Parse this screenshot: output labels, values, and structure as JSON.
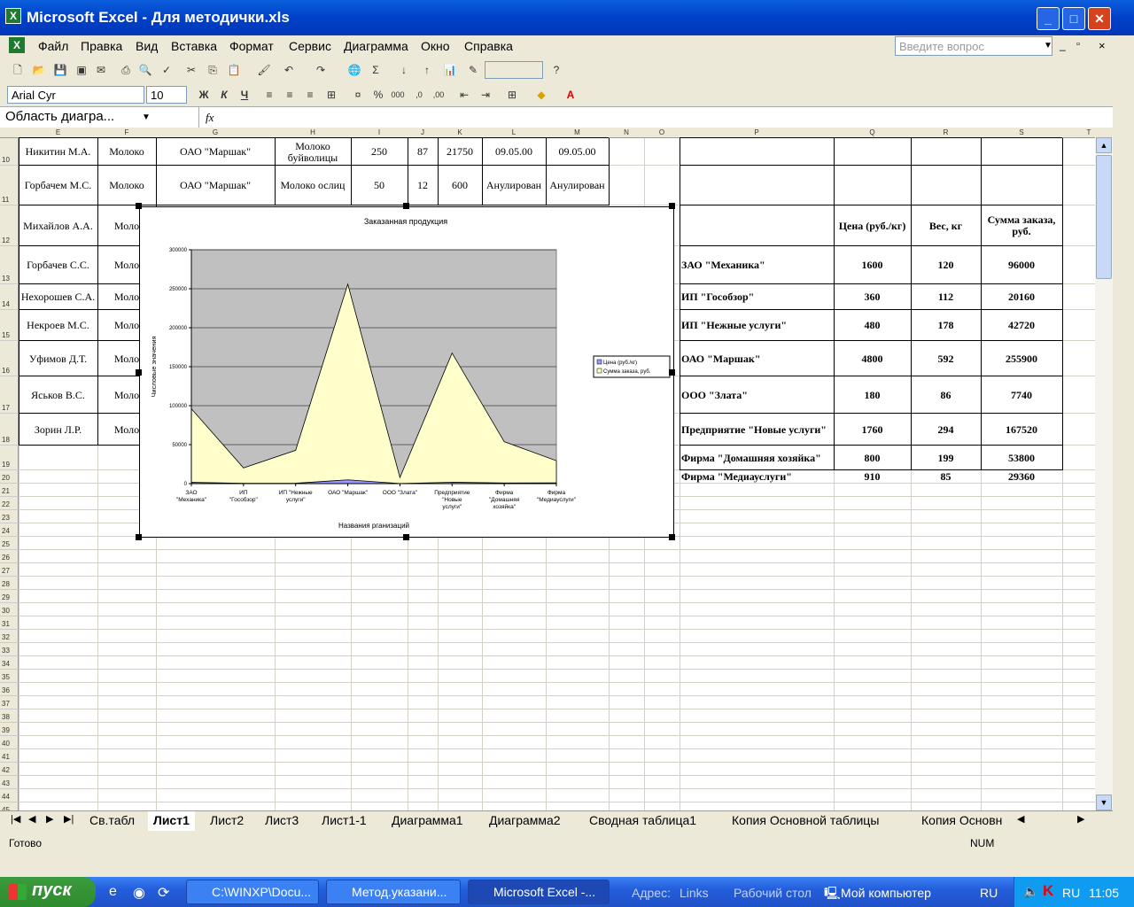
{
  "window": {
    "title": "Microsoft Excel - Для методички.xls",
    "min": "_",
    "max": "□",
    "close": "✕"
  },
  "menu": [
    "Файл",
    "Правка",
    "Вид",
    "Вставка",
    "Формат",
    "Сервис",
    "Диаграмма",
    "Окно",
    "Справка"
  ],
  "ask_placeholder": "Введите вопрос",
  "formatting": {
    "font": "Arial Cyr",
    "size": "10",
    "bold": "Ж",
    "italic": "К",
    "underline": "Ч"
  },
  "namebox": "Область диагра...",
  "fx": "fx",
  "columns": [
    "E",
    "F",
    "G",
    "H",
    "I",
    "J",
    "K",
    "L",
    "M",
    "N",
    "O",
    "P",
    "Q",
    "R",
    "S",
    "T"
  ],
  "rows_left": [
    {
      "n": "10",
      "e": "Никитин М.А.",
      "f": "Молоко",
      "g": "ОАО \"Маршак\"",
      "h": "Молоко буйволицы",
      "i": "250",
      "j": "87",
      "k": "21750",
      "l": "09.05.00",
      "m": "09.05.00"
    },
    {
      "n": "11",
      "e": "Горбачем М.С.",
      "f": "Молоко",
      "g": "ОАО \"Маршак\"",
      "h": "Молоко ослиц",
      "i": "50",
      "j": "12",
      "k": "600",
      "l": "Анулирован",
      "m": "Анулирован"
    },
    {
      "n": "12",
      "e": "Михайлов А.А.",
      "f": "Моло"
    },
    {
      "n": "13",
      "e": "Горбачев С.С.",
      "f": "Моло"
    },
    {
      "n": "14",
      "e": "Нехорошев С.А.",
      "f": "Моло"
    },
    {
      "n": "15",
      "e": "Некроев М.С.",
      "f": "Моло"
    },
    {
      "n": "16",
      "e": "Уфимов Д.Т.",
      "f": "Моло"
    },
    {
      "n": "17",
      "e": "Яськов В.С.",
      "f": "Моло"
    },
    {
      "n": "18",
      "e": "Зорин Л.Р.",
      "f": "Моло"
    }
  ],
  "summary_headers": {
    "q": "Цена (руб./кг)",
    "r": "Вес, кг",
    "s": "Сумма заказа, руб."
  },
  "summary": [
    {
      "p": "ЗАО \"Механика\"",
      "q": "1600",
      "r": "120",
      "s": "96000"
    },
    {
      "p": "ИП \"Гособзор\"",
      "q": "360",
      "r": "112",
      "s": "20160"
    },
    {
      "p": "ИП \"Нежные услуги\"",
      "q": "480",
      "r": "178",
      "s": "42720"
    },
    {
      "p": "ОАО \"Маршак\"",
      "q": "4800",
      "r": "592",
      "s": "255900"
    },
    {
      "p": "ООО \"Злата\"",
      "q": "180",
      "r": "86",
      "s": "7740"
    },
    {
      "p": "Предприятие \"Новые услуги\"",
      "q": "1760",
      "r": "294",
      "s": "167520"
    },
    {
      "p": "Фирма \"Домашняя хозяйка\"",
      "q": "800",
      "r": "199",
      "s": "53800"
    },
    {
      "p": "Фирма \"Медиауслуги\"",
      "q": "910",
      "r": "85",
      "s": "29360"
    }
  ],
  "chart_data": {
    "type": "area",
    "title": "Заказанная продукция",
    "xlabel": "Названия рганизаций",
    "ylabel": "Числовые значения",
    "ylim": [
      0,
      300000
    ],
    "yticks": [
      "0",
      "50000",
      "100000",
      "150000",
      "200000",
      "250000",
      "300000"
    ],
    "categories": [
      "ЗАО \"Механика\"",
      "ИП \"Гособзор\"",
      "ИП \"Нежные услуги\"",
      "ОАО \"Маршак\"",
      "ООО \"Злата\"",
      "Предприятие \"Новые услуги\"",
      "Фирма \"Домашняя хозяйка\"",
      "Фирма \"Медиауслуги\""
    ],
    "series": [
      {
        "name": "Цена (руб./кг)",
        "values": [
          1600,
          360,
          480,
          4800,
          180,
          1760,
          800,
          910
        ],
        "color": "#9999FF"
      },
      {
        "name": "Сумма заказа, руб.",
        "values": [
          96000,
          20160,
          42720,
          255900,
          7740,
          167520,
          53800,
          29360
        ],
        "color": "#FFFFCC"
      }
    ],
    "plot_bg": "#C0C0C0",
    "legend": "right",
    "grid": true
  },
  "sheet_tabs": [
    "Св.табл",
    "Лист1",
    "Лист2",
    "Лист3",
    "Лист1-1",
    "Диаграмма1",
    "Диаграмма2",
    "Сводная таблица1",
    "Копия Основной таблицы",
    "Копия Основн"
  ],
  "active_tab": "Лист1",
  "status": {
    "ready": "Готово",
    "num": "NUM"
  },
  "taskbar": {
    "start": "пуск",
    "tasks": [
      "C:\\WINXP\\Docu...",
      "Метод.указани...",
      "Microsoft Excel -..."
    ],
    "address": "Адрес:",
    "links": "Links",
    "desktop": "Рабочий стол",
    "mycomp": "Мой компьютер",
    "lang": "RU",
    "lang2": "RU",
    "time": "11:05"
  }
}
